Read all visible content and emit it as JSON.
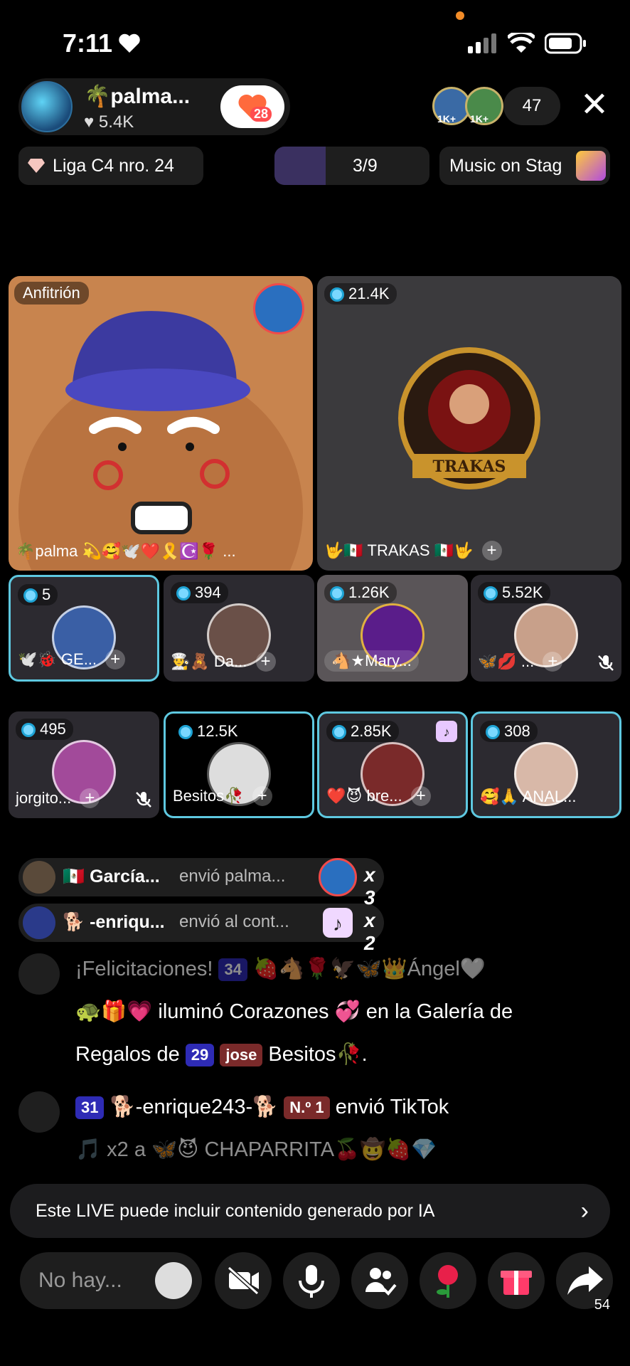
{
  "status_bar": {
    "time": "7:11"
  },
  "header": {
    "host_name": "palma...",
    "host_likes": "5.4K",
    "follow_count": "28",
    "viewer_badges": [
      "1K+",
      "1K+"
    ],
    "viewer_count": "47"
  },
  "chips": {
    "league": "Liga C4 nro. 24",
    "ranking": "3/9",
    "music": "Music on Stag"
  },
  "host_tile": {
    "badge": "Anfitrión",
    "label": "palma"
  },
  "trakas_tile": {
    "score": "21.4K",
    "label": "TRAKAS",
    "logo_text": "TRAKAS"
  },
  "guests": [
    {
      "score": "5",
      "name": "GE..."
    },
    {
      "score": "394",
      "name": "Da..."
    },
    {
      "score": "1.26K",
      "name": "★Mary..."
    },
    {
      "score": "5.52K",
      "name": "..."
    },
    {
      "score": "495",
      "name": "jorgito..."
    },
    {
      "score": "12.5K",
      "name": "Besitos"
    },
    {
      "score": "2.85K",
      "name": "bre..."
    },
    {
      "score": "308",
      "name": "ANAL..."
    }
  ],
  "gift_feed": [
    {
      "name": "García...",
      "action": "envió palma...",
      "multiplier": "x 3"
    },
    {
      "name": "-enriqu...",
      "action": "envió al cont...",
      "multiplier": "x 2"
    }
  ],
  "chat": [
    {
      "line1_title": "¡Felicitaciones!",
      "line1_badge": "34",
      "line1_tail": "Ángel",
      "line2_text": "iluminó Corazones",
      "line2_tail": "en la Galería de",
      "line3_prefix": "Regalos de",
      "line3_badge1": "29",
      "line3_badge2": "jose",
      "line3_name": "Besitos"
    },
    {
      "badge": "31",
      "user": "-enrique243-",
      "rank": "N.º 1",
      "action": "envió TikTok",
      "line2": "x2 a",
      "recipient": "CHAPARRITA"
    }
  ],
  "ai_banner": "Este LIVE puede incluir contenido generado por IA",
  "bottom": {
    "placeholder": "No hay...",
    "share_count": "54"
  }
}
